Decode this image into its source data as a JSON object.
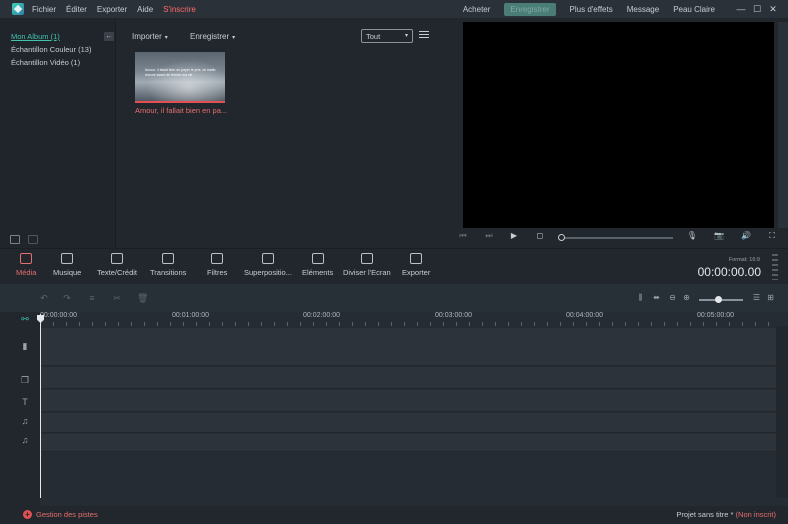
{
  "menu": {
    "items": [
      "Fichier",
      "Éditer",
      "Exporter",
      "Aide"
    ],
    "signup": "S'inscrire"
  },
  "topnav": {
    "buy": "Acheter",
    "register": "Enregistrer",
    "more_effects": "Plus d'effets",
    "message": "Message",
    "skin": "Peau Claire"
  },
  "library": {
    "items": [
      "Mon Album (1)",
      "Échantillon Couleur (13)",
      "Échantillon Vidéo (1)"
    ]
  },
  "media": {
    "import_label": "Importer",
    "record_label": "Enregistrer",
    "filter_value": "Tout",
    "clip_title": "Amour, il fallait bien en pa...",
    "clip_caption": "Amour, il fallait bien en payer le prix, ce matin encore avant de fermer ma vie"
  },
  "modules": {
    "items": [
      {
        "label": "Média",
        "icon": "folder-icon"
      },
      {
        "label": "Musique",
        "icon": "music-icon"
      },
      {
        "label": "Texte/Crédit",
        "icon": "text-icon"
      },
      {
        "label": "Transitions",
        "icon": "transition-icon"
      },
      {
        "label": "Filtres",
        "icon": "filter-icon"
      },
      {
        "label": "Superpositio...",
        "icon": "overlay-icon"
      },
      {
        "label": "Eléments",
        "icon": "image-icon"
      },
      {
        "label": "Diviser l'Ecran",
        "icon": "split-screen-icon"
      },
      {
        "label": "Exporter",
        "icon": "export-icon"
      }
    ],
    "format": "Format: 16:9",
    "timecode": "00:00:00.00"
  },
  "timeline": {
    "ruler": [
      "00:00:00:00",
      "00:01:00:00",
      "00:02:00:00",
      "00:03:00:00",
      "00:04:00:00",
      "00:05:00:00"
    ]
  },
  "status": {
    "tracks_label": "Gestion des pistes",
    "project": "Projet sans titre *",
    "unregistered": "(Non inscrit)"
  },
  "colors": {
    "accent": "#e44f53",
    "library_active": "#41c3ae",
    "background": "#22272d"
  }
}
